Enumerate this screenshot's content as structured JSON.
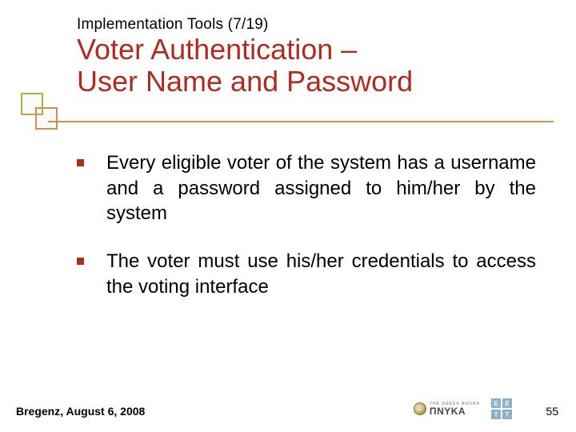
{
  "header": {
    "breadcrumb": "Implementation Tools (7/19)",
    "title_line1": "Voter Authentication –",
    "title_line2": "User Name and Password"
  },
  "bullets": [
    "Every eligible voter of the system has a username and a password assigned to him/her by the system",
    "The voter must use his/her credentials to access the voting interface"
  ],
  "footer": {
    "location_date": "Bregenz, August 6, 2008",
    "page_number": "55"
  },
  "logos": {
    "pnyka_sub": "THE GREEK AGORA",
    "pnyka_main": "ΠNYKA",
    "eett_letters": [
      "E",
      "E",
      "T",
      "T"
    ]
  }
}
